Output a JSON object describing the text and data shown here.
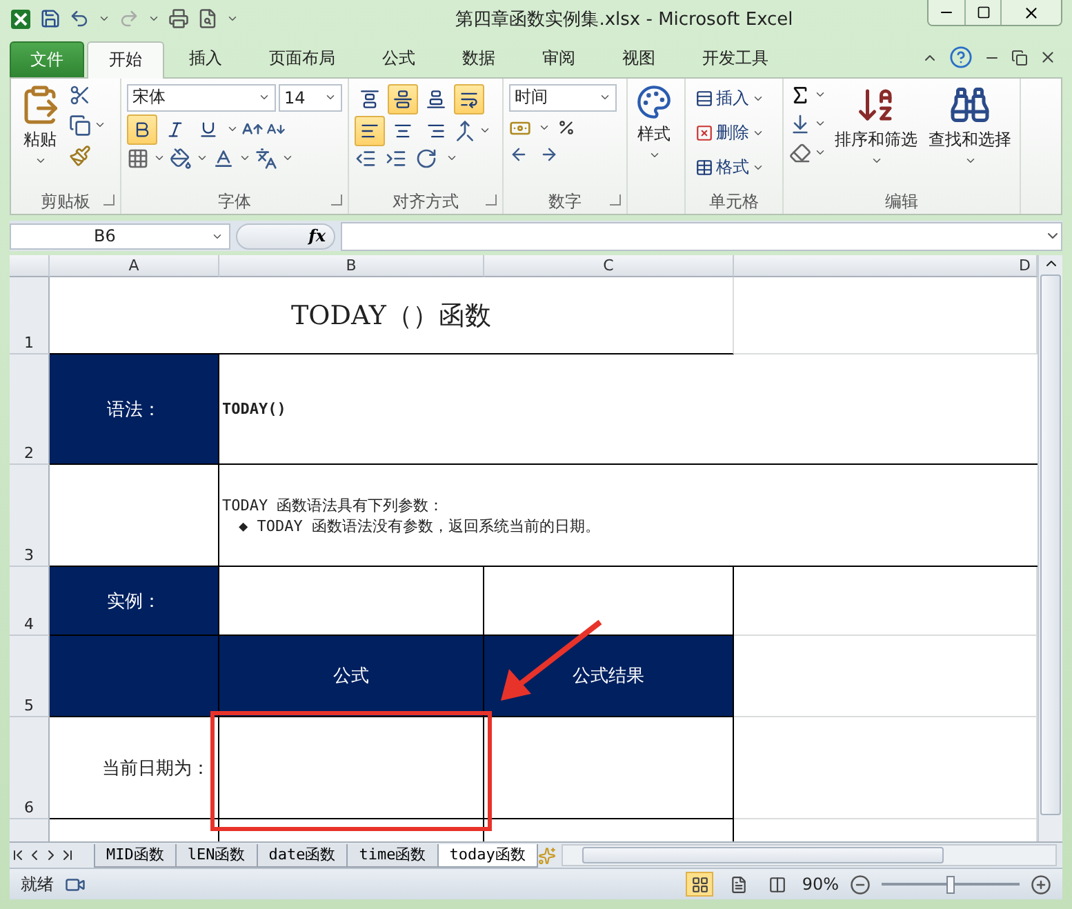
{
  "window": {
    "title": "第四章函数实例集.xlsx  -  Microsoft Excel"
  },
  "ribbon_tabs": [
    {
      "label": "文件",
      "kind": "file",
      "selected": false
    },
    {
      "label": "开始",
      "kind": "tab",
      "selected": true
    },
    {
      "label": "插入",
      "kind": "tab",
      "selected": false
    },
    {
      "label": "页面布局",
      "kind": "tab",
      "selected": false
    },
    {
      "label": "公式",
      "kind": "tab",
      "selected": false
    },
    {
      "label": "数据",
      "kind": "tab",
      "selected": false
    },
    {
      "label": "审阅",
      "kind": "tab",
      "selected": false
    },
    {
      "label": "视图",
      "kind": "tab",
      "selected": false
    },
    {
      "label": "开发工具",
      "kind": "tab",
      "selected": false
    }
  ],
  "clipboard": {
    "paste": "粘贴",
    "label": "剪贴板"
  },
  "font": {
    "name": "宋体",
    "size": "14",
    "bold": true,
    "italic": false,
    "underline": false,
    "label": "字体"
  },
  "alignment": {
    "top": false,
    "middle": true,
    "bottom": false,
    "wrap": true,
    "left": true,
    "center": false,
    "right": false,
    "label": "对齐方式"
  },
  "number": {
    "format": "时间",
    "label": "数字"
  },
  "styles": {
    "button": "样式"
  },
  "cells": {
    "insert": "插入",
    "delete": "删除",
    "format": "格式",
    "label": "单元格"
  },
  "editing": {
    "sort": "排序和筛选",
    "find": "查找和选择",
    "label": "编辑"
  },
  "formula_bar": {
    "name_box": "B6",
    "function_button": "fx"
  },
  "columns": [
    "A",
    "B",
    "C",
    "D"
  ],
  "rows": [
    {
      "number": "1",
      "cells": [
        {
          "kind": "title",
          "text": "TODAY（）函数"
        },
        {
          "kind": "plain"
        }
      ]
    },
    {
      "number": "2",
      "cells": [
        {
          "kind": "dark",
          "text": "语法："
        },
        {
          "kind": "code",
          "text": "TODAY()"
        }
      ]
    },
    {
      "number": "3",
      "cells": [
        {
          "kind": "boxed"
        },
        {
          "kind": "note",
          "lines": [
            "TODAY 函数语法具有下列参数：",
            "◆ TODAY 函数语法没有参数，返回系统当前的日期。"
          ]
        }
      ]
    },
    {
      "number": "4",
      "cells": [
        {
          "kind": "dark",
          "text": "实例："
        },
        {
          "kind": "boxed"
        },
        {
          "kind": "boxed"
        },
        {
          "kind": "plain"
        }
      ]
    },
    {
      "number": "5",
      "cells": [
        {
          "kind": "dark"
        },
        {
          "kind": "dark",
          "text": "公式"
        },
        {
          "kind": "dark",
          "text": "公式结果"
        },
        {
          "kind": "plain"
        }
      ]
    },
    {
      "number": "6",
      "cells": [
        {
          "kind": "label",
          "text": "当前日期为："
        },
        {
          "kind": "boxed"
        },
        {
          "kind": "boxed"
        },
        {
          "kind": "plain"
        }
      ]
    },
    {
      "cells": [
        {
          "kind": "boxed"
        },
        {
          "kind": "boxed"
        },
        {
          "kind": "boxed"
        },
        {
          "kind": "plain"
        }
      ]
    }
  ],
  "sheet_tabs": [
    {
      "label": "MID函数",
      "selected": false
    },
    {
      "label": "lEN函数",
      "selected": false
    },
    {
      "label": "date函数",
      "selected": false
    },
    {
      "label": "time函数",
      "selected": false
    },
    {
      "label": "today函数",
      "selected": true
    }
  ],
  "status_bar": {
    "status": "就绪",
    "views": [
      {
        "kind": "normal",
        "selected": true
      },
      {
        "kind": "layout",
        "selected": false
      },
      {
        "kind": "pagebreak",
        "selected": false
      }
    ],
    "zoom": "90%",
    "zoom_level": {
      "level": 0.5
    }
  }
}
